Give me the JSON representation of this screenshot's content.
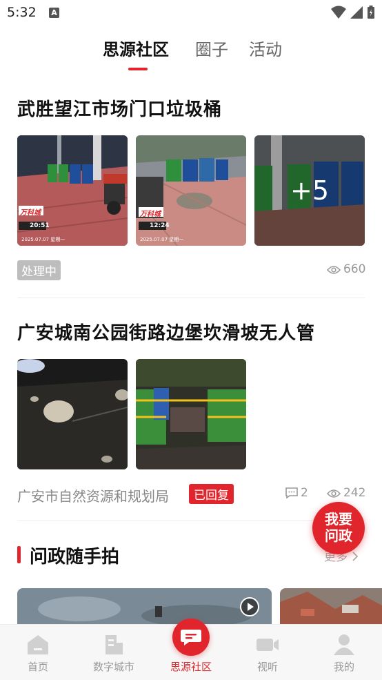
{
  "status_bar": {
    "time": "5:32",
    "notification_icon": "A"
  },
  "top_tabs": [
    {
      "label": "思源社区",
      "active": true
    },
    {
      "label": "圈子",
      "active": false
    },
    {
      "label": "活动",
      "active": false
    }
  ],
  "posts": [
    {
      "title": "武胜望江市场门口垃圾桶",
      "images": [
        {
          "stamp_logo": "万科城",
          "stamp_time": "20:51",
          "stamp_date": "2025.07.07 星期一"
        },
        {
          "stamp_logo": "万科城",
          "stamp_time": "12:24",
          "stamp_date": "2025.07.07 星期一"
        },
        {
          "more_count": "+5"
        }
      ],
      "status": "处理中",
      "views": "660"
    },
    {
      "title": "广安城南公园街路边堡坎滑坡无人管",
      "department": "广安市自然资源和规划局",
      "status": "已回复",
      "comments": "2",
      "views": "242"
    }
  ],
  "fab": {
    "line1": "我要",
    "line2": "问政"
  },
  "section": {
    "title": "问政随手拍",
    "more": "更多"
  },
  "bottom_nav": [
    {
      "label": "首页",
      "icon": "home-icon"
    },
    {
      "label": "数字城市",
      "icon": "building-icon"
    },
    {
      "label": "思源社区",
      "icon": "chat-icon",
      "active": true
    },
    {
      "label": "视听",
      "icon": "video-icon"
    },
    {
      "label": "我的",
      "icon": "profile-icon"
    }
  ],
  "colors": {
    "accent": "#e0262c",
    "muted": "#999999"
  }
}
